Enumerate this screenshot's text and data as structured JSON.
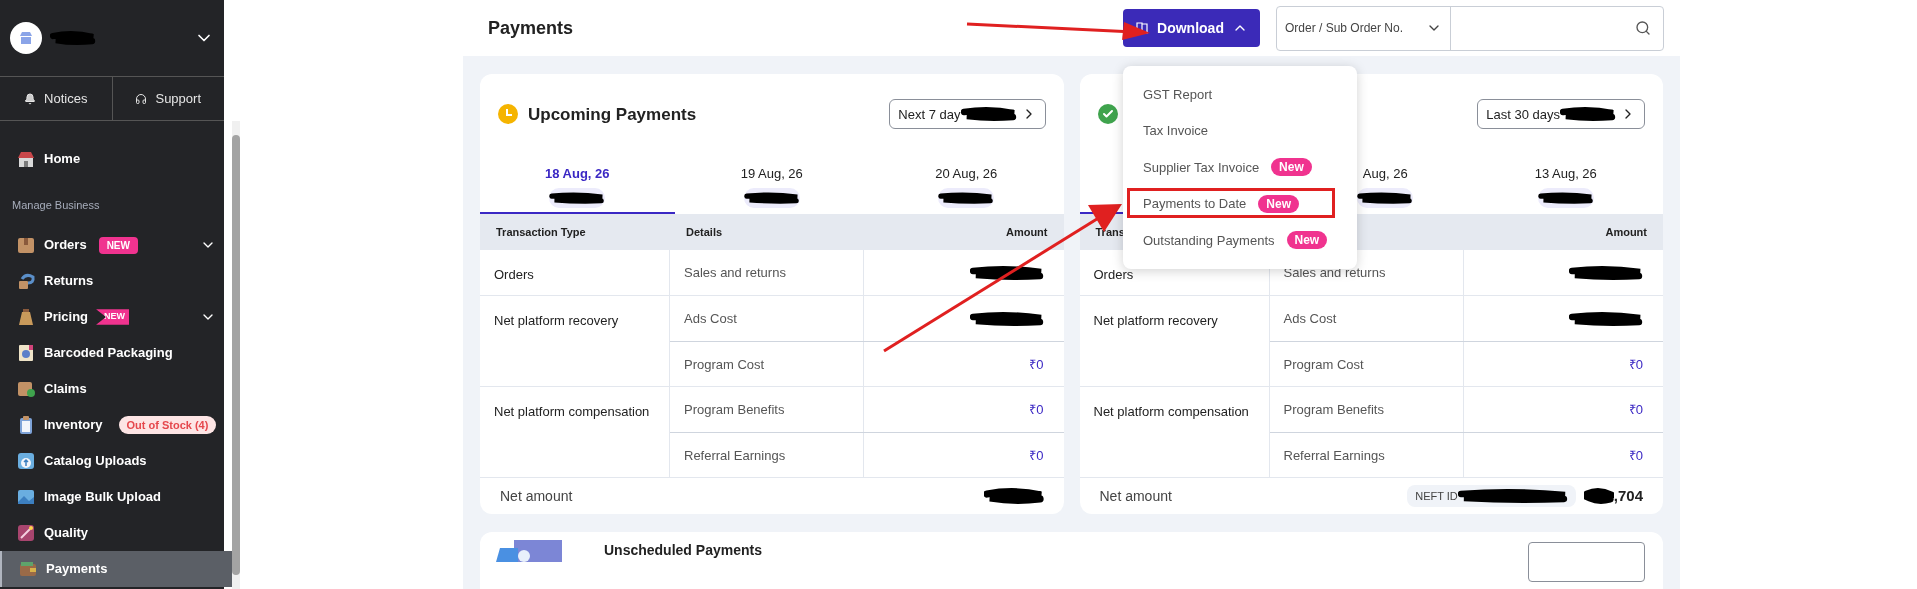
{
  "sidebar": {
    "account": {
      "redacted": true
    },
    "quick_links": [
      {
        "label": "Notices"
      },
      {
        "label": "Support"
      }
    ],
    "nav": [
      {
        "kind": "item",
        "label": "Home",
        "expandable": false,
        "selected": false
      },
      {
        "kind": "section",
        "label": "Manage Business"
      },
      {
        "kind": "item",
        "label": "Orders",
        "badge": {
          "text": "NEW",
          "kind": "pill"
        },
        "expandable": true,
        "selected": false
      },
      {
        "kind": "item",
        "label": "Returns",
        "expandable": false,
        "selected": false
      },
      {
        "kind": "item",
        "label": "Pricing",
        "badge": {
          "text": "NEW",
          "kind": "ribbon"
        },
        "expandable": true,
        "selected": false
      },
      {
        "kind": "item",
        "label": "Barcoded Packaging",
        "expandable": false,
        "selected": false
      },
      {
        "kind": "item",
        "label": "Claims",
        "expandable": false,
        "selected": false
      },
      {
        "kind": "item",
        "label": "Inventory",
        "badge": {
          "text": "Out of Stock (4)",
          "kind": "alert"
        },
        "expandable": false,
        "selected": false
      },
      {
        "kind": "item",
        "label": "Catalog Uploads",
        "expandable": false,
        "selected": false
      },
      {
        "kind": "item",
        "label": "Image Bulk Upload",
        "expandable": false,
        "selected": false
      },
      {
        "kind": "item",
        "label": "Quality",
        "expandable": false,
        "selected": false
      },
      {
        "kind": "item",
        "label": "Payments",
        "expandable": false,
        "selected": true
      }
    ]
  },
  "header": {
    "title": "Payments",
    "download": {
      "label": "Download",
      "expanded": true
    },
    "search": {
      "filter": "Order / Sub Order No."
    }
  },
  "download_menu": [
    {
      "label": "GST Report",
      "annotated": false
    },
    {
      "label": "Tax Invoice",
      "annotated": false
    },
    {
      "label": "Supplier Tax Invoice",
      "badge": "New",
      "annotated": false
    },
    {
      "label": "Payments to Date",
      "badge": "New",
      "annotated": true
    },
    {
      "label": "Outstanding Payments",
      "badge": "New",
      "annotated": false
    }
  ],
  "cards": [
    {
      "kind": "upcoming",
      "title": "Upcoming Payments",
      "range": {
        "label": "Next 7 day",
        "redacted": true
      },
      "tabs": [
        {
          "date": "18 Aug, 26",
          "selected": true
        },
        {
          "date": "19 Aug, 26",
          "selected": false
        },
        {
          "date": "20 Aug, 26",
          "selected": false
        }
      ],
      "column_1": "Transaction Type",
      "column_2": "Details",
      "column_3": "Amount",
      "groups": [
        {
          "type": "Orders",
          "rows": [
            {
              "detail": "Sales and returns",
              "redacted": true
            }
          ]
        },
        {
          "type": "Net platform recovery",
          "rows": [
            {
              "detail": "Ads Cost",
              "redacted": true
            },
            {
              "detail": "Program Cost",
              "amount": "₹0",
              "redacted": false
            }
          ]
        },
        {
          "type": "Net platform compensation",
          "rows": [
            {
              "detail": "Program Benefits",
              "amount": "₹0",
              "redacted": false
            },
            {
              "detail": "Referral Earnings",
              "amount": "₹0",
              "redacted": false
            }
          ]
        }
      ],
      "net": {
        "label": "Net amount",
        "redacted": true
      }
    },
    {
      "kind": "settled",
      "range": {
        "label": "Last 30 days",
        "redacted": true
      },
      "tabs": [
        {
          "selected": true
        },
        {
          "date": "Aug, 26",
          "selected": false
        },
        {
          "date": "13 Aug, 26",
          "selected": false
        }
      ],
      "column_1": "Trans",
      "column_3": "Amount",
      "groups": [
        {
          "type": "Orders",
          "rows": [
            {
              "detail": "Sales and returns",
              "redacted": true
            }
          ]
        },
        {
          "type": "Net platform recovery",
          "rows": [
            {
              "detail": "Ads Cost",
              "redacted": true
            },
            {
              "detail": "Program Cost",
              "amount": "₹0",
              "redacted": false
            }
          ]
        },
        {
          "type": "Net platform compensation",
          "rows": [
            {
              "detail": "Program Benefits",
              "amount": "₹0",
              "redacted": false
            },
            {
              "detail": "Referral Earnings",
              "amount": "₹0",
              "redacted": false
            }
          ]
        }
      ],
      "net": {
        "label": "Net amount",
        "neft_label": "NEFT ID",
        "amount_suffix": ",704",
        "redacted": true
      }
    }
  ],
  "unscheduled": {
    "title": "Unscheduled Payments"
  }
}
